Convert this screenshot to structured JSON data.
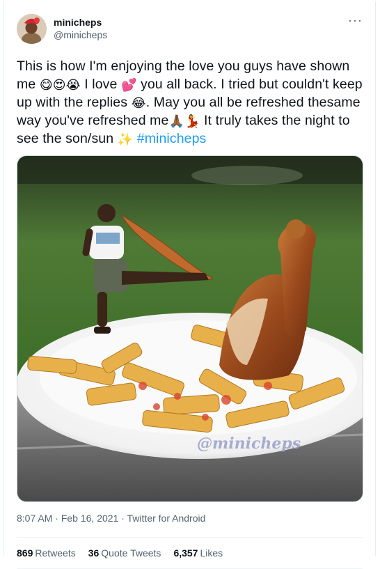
{
  "author": {
    "display_name": "minicheps",
    "handle": "@minicheps",
    "avatar_icon": "avatar-photo",
    "more_icon": "more-dots-icon"
  },
  "tweet": {
    "segments": [
      {
        "type": "text",
        "value": "This is how I'm enjoying the love you guys have shown me "
      },
      {
        "type": "emoji",
        "value": "😋"
      },
      {
        "type": "emoji",
        "value": "😍"
      },
      {
        "type": "emoji",
        "value": "😭"
      },
      {
        "type": "text",
        "value": " I love "
      },
      {
        "type": "emoji",
        "value": "💕"
      },
      {
        "type": "text",
        "value": " you all back. I tried but couldn't keep up with the replies "
      },
      {
        "type": "emoji",
        "value": "😂"
      },
      {
        "type": "text",
        "value": ". May you all be refreshed thesame way you've refreshed me"
      },
      {
        "type": "emoji",
        "value": "🙏🏾"
      },
      {
        "type": "emoji",
        "value": "💃"
      },
      {
        "type": "text",
        "value": " It truly takes the night to see the son/sun "
      },
      {
        "type": "emoji",
        "value": "✨"
      },
      {
        "type": "text",
        "value": " "
      },
      {
        "type": "hashtag",
        "value": "#minicheps"
      }
    ],
    "image_watermark": "@minicheps"
  },
  "meta": {
    "time": "8:07 AM",
    "sep1": " · ",
    "date": "Feb 16, 2021",
    "sep2": " · ",
    "app": "Twitter for Android"
  },
  "stats": {
    "retweets_count": "869",
    "retweets_label": "Retweets",
    "quotes_count": "36",
    "quotes_label": "Quote Tweets",
    "likes_count": "6,357",
    "likes_label": "Likes"
  },
  "colors": {
    "link": "#1d9bf0",
    "secondary_text": "#536471",
    "primary_text": "#0f1419"
  }
}
